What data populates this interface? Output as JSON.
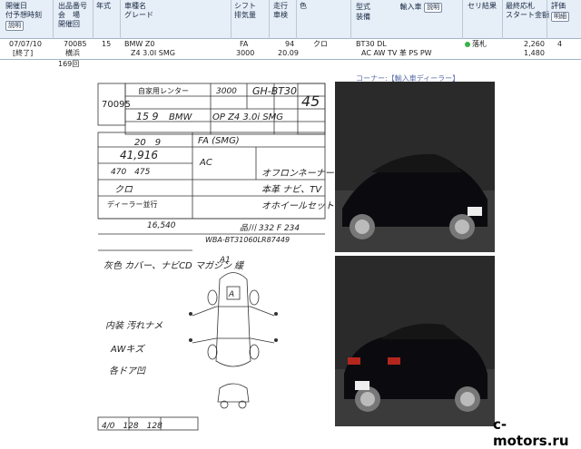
{
  "header": {
    "col1_a": "開催日",
    "col1_b": "付予想時刻",
    "col1_btn": "説明",
    "col2_a": "出品番号",
    "col2_b": "会　場",
    "col2_c": "開催回",
    "col3": "年式",
    "col4_a": "車種名",
    "col4_b": "グレード",
    "col5_a": "シフト",
    "col5_b": "排気量",
    "col6_a": "走行",
    "col6_b": "車検",
    "col7": "色",
    "col8_a": "型式",
    "col8_b": "装備",
    "col8_import": "輸入車",
    "col8_btn": "説明",
    "col9": "セリ結果",
    "col10_a": "最終応札",
    "col10_b": "スタート金額",
    "col11_a": "評価",
    "col11_btn": "明細"
  },
  "row": {
    "date": "07/07/10",
    "end_btn": "[終了]",
    "lot": "70085",
    "venue": "横浜",
    "session": "169回",
    "year": "15",
    "model": "BMW Z0",
    "grade": "Z4 3.0I SMG",
    "shift": "FA",
    "displacement": "3000",
    "mileage": "94",
    "inspection": "20.09",
    "color": "クロ",
    "type_code": "BT30 DL",
    "equipment": "AC AW TV 革 PS PW",
    "result": "落札",
    "final_bid": "2,260",
    "start_price": "1,480",
    "rating": "4"
  },
  "corner_label": "コーナー:【輸入車ディーラー】",
  "sheet": {
    "lot_box": "70095",
    "type_hand": "GH-BT30",
    "cc_hand": "3000",
    "score_hand": "45",
    "lessee": "自家用レンター",
    "year_hand": "15 9",
    "maker_hand": "BMW",
    "grade_hand": "OP Z4 3.0i SMG",
    "inspection_hand": "20　9",
    "mileage_hand": "41,916",
    "shift_hand": "FA (SMG)",
    "ac_hand": "AC",
    "dims": "470　475",
    "color_hand": "クロ",
    "dealer": "ディーラー並行",
    "recycle": "16,540",
    "number": "品川 332 F 234",
    "notes_1": "オフロンネーナー",
    "notes_2": "本革 ナビ、TV",
    "notes_3": "オホイールセット",
    "chassis": "WBA-BT31060LR87449",
    "remarks": "灰色 カバー、ナビCD マガジン 緩",
    "inspector_1": "内装 汚れナメ",
    "inspector_2": "AWキズ",
    "inspector_3": "各ドア凹",
    "diagram_a1": "A1",
    "diagram_a_top": "A",
    "bottom_nums": "4/0　128　128"
  },
  "watermark": "c-motors.ru"
}
